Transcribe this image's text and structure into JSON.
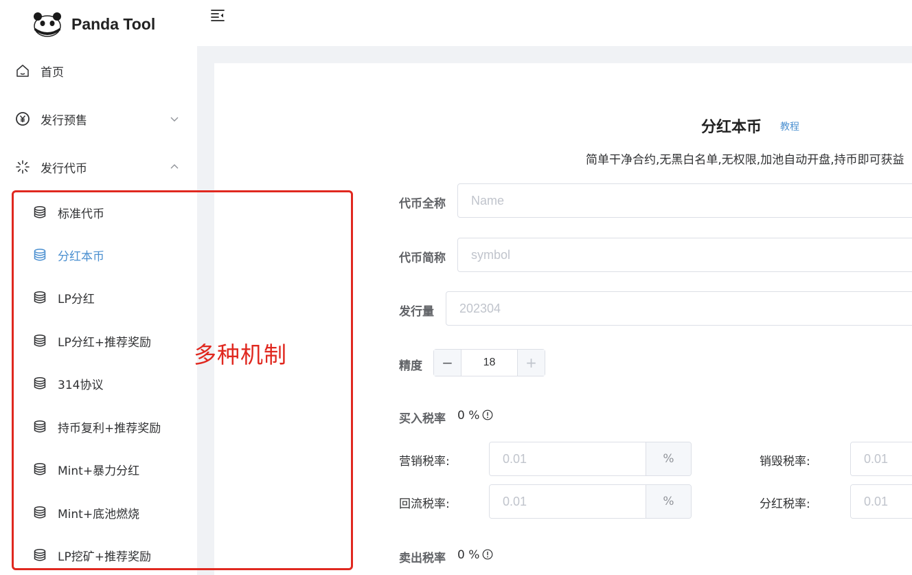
{
  "brand": {
    "name": "Panda Tool"
  },
  "sidebar": {
    "menu": [
      {
        "label": "首页",
        "icon": "home-icon"
      },
      {
        "label": "发行预售",
        "icon": "yen-coin-icon",
        "expanded": false
      },
      {
        "label": "发行代币",
        "icon": "loading-spinner-icon",
        "expanded": true
      }
    ],
    "submenu": [
      {
        "label": "标准代币",
        "active": false
      },
      {
        "label": "分红本币",
        "active": true
      },
      {
        "label": "LP分红",
        "active": false
      },
      {
        "label": "LP分红+推荐奖励",
        "active": false
      },
      {
        "label": "314协议",
        "active": false
      },
      {
        "label": "持币复利+推荐奖励",
        "active": false
      },
      {
        "label": "Mint+暴力分红",
        "active": false
      },
      {
        "label": "Mint+底池燃烧",
        "active": false
      },
      {
        "label": "LP挖矿+推荐奖励",
        "active": false
      }
    ]
  },
  "annotation": {
    "text": "多种机制",
    "color": "#e0281f"
  },
  "page": {
    "title": "分红本币",
    "tutorial": "教程",
    "description": "简单干净合约,无黑白名单,无权限,加池自动开盘,持币即可获益"
  },
  "form": {
    "token_name": {
      "label": "代币全称",
      "placeholder": "Name",
      "value": ""
    },
    "token_symbol": {
      "label": "代币简称",
      "placeholder": "symbol",
      "value": ""
    },
    "supply": {
      "label": "发行量",
      "placeholder": "202304",
      "value": ""
    },
    "precision": {
      "label": "精度",
      "value": "18",
      "minus": "−",
      "plus": "+"
    },
    "buy_tax": {
      "label": "买入税率",
      "value": "0 %"
    },
    "marketing_tax": {
      "label": "营销税率:",
      "placeholder": "0.01",
      "suffix": "%"
    },
    "burn_tax": {
      "label": "销毁税率:",
      "placeholder": "0.01"
    },
    "reflow_tax": {
      "label": "回流税率:",
      "placeholder": "0.01",
      "suffix": "%"
    },
    "dividend_tax": {
      "label": "分红税率:",
      "placeholder": "0.01"
    },
    "sell_tax": {
      "label": "卖出税率",
      "value": "0 %"
    }
  },
  "colors": {
    "accent": "#4a8fd0",
    "annotation": "#e0281f",
    "background": "#f0f2f5"
  }
}
